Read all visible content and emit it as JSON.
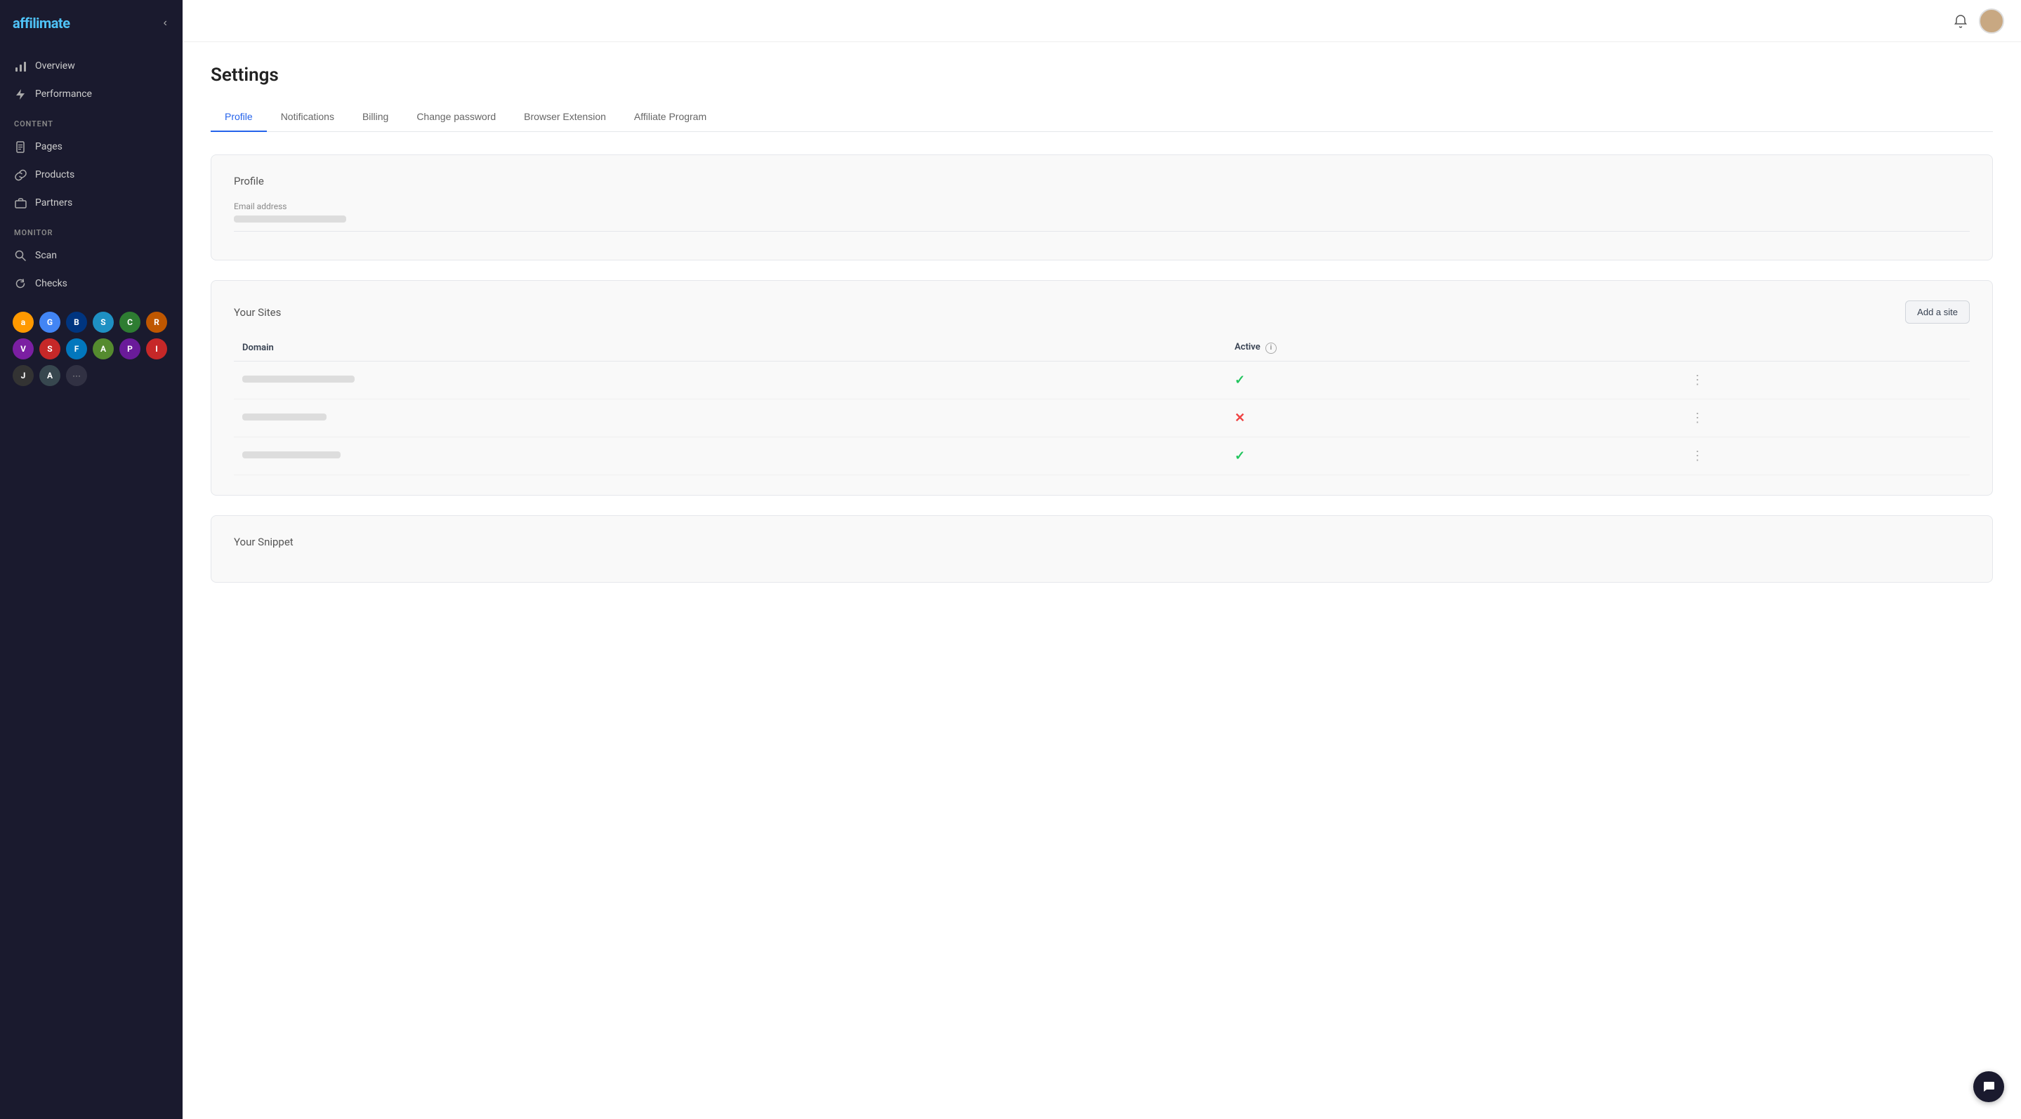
{
  "app": {
    "logo": "affilimate",
    "logo_accent": "·"
  },
  "sidebar": {
    "collapse_label": "‹",
    "nav_items": [
      {
        "id": "overview",
        "label": "Overview",
        "icon": "chart-icon"
      },
      {
        "id": "performance",
        "label": "Performance",
        "icon": "lightning-icon"
      }
    ],
    "sections": [
      {
        "label": "CONTENT",
        "items": [
          {
            "id": "pages",
            "label": "Pages",
            "icon": "page-icon"
          },
          {
            "id": "products",
            "label": "Products",
            "icon": "link-icon"
          },
          {
            "id": "partners",
            "label": "Partners",
            "icon": "briefcase-icon"
          }
        ]
      },
      {
        "label": "MONITOR",
        "items": [
          {
            "id": "scan",
            "label": "Scan",
            "icon": "search-icon"
          },
          {
            "id": "checks",
            "label": "Checks",
            "icon": "refresh-icon"
          }
        ]
      }
    ],
    "partner_icons": [
      {
        "id": "amazon",
        "letter": "a",
        "bg": "#FF9900",
        "color": "#fff"
      },
      {
        "id": "google",
        "letter": "G",
        "bg": "#4285F4",
        "color": "#fff"
      },
      {
        "id": "booking",
        "letter": "B",
        "bg": "#003580",
        "color": "#fff"
      },
      {
        "id": "skimlinks",
        "letter": "S",
        "bg": "#1e90c3",
        "color": "#fff"
      },
      {
        "id": "cj",
        "letter": "C",
        "bg": "#2e7d32",
        "color": "#fff"
      },
      {
        "id": "rakuten",
        "letter": "R",
        "bg": "#bf5700",
        "color": "#fff"
      },
      {
        "id": "viglink",
        "letter": "V",
        "bg": "#7b1fa2",
        "color": "#fff"
      },
      {
        "id": "shareasale",
        "letter": "S",
        "bg": "#c62828",
        "color": "#fff"
      },
      {
        "id": "flexoffers",
        "letter": "F",
        "bg": "#0277bd",
        "color": "#fff"
      },
      {
        "id": "awin",
        "letter": "A",
        "bg": "#558b2f",
        "color": "#fff"
      },
      {
        "id": "partnerize",
        "letter": "P",
        "bg": "#6a1b9a",
        "color": "#fff"
      },
      {
        "id": "impact",
        "letter": "I",
        "bg": "#c62828",
        "color": "#fff"
      },
      {
        "id": "jrp",
        "letter": "J",
        "bg": "#333",
        "color": "#fff"
      },
      {
        "id": "other",
        "letter": "A",
        "bg": "#37474f",
        "color": "#fff"
      },
      {
        "id": "more",
        "letter": "···",
        "bg": "rgba(255,255,255,0.12)",
        "color": "#aaa"
      }
    ]
  },
  "topbar": {
    "bell_label": "🔔",
    "avatar_initials": "👤"
  },
  "page": {
    "title": "Settings"
  },
  "tabs": [
    {
      "id": "profile",
      "label": "Profile",
      "active": true
    },
    {
      "id": "notifications",
      "label": "Notifications",
      "active": false
    },
    {
      "id": "billing",
      "label": "Billing",
      "active": false
    },
    {
      "id": "change-password",
      "label": "Change password",
      "active": false
    },
    {
      "id": "browser-extension",
      "label": "Browser Extension",
      "active": false
    },
    {
      "id": "affiliate-program",
      "label": "Affiliate Program",
      "active": false
    }
  ],
  "profile_section": {
    "title": "Profile",
    "email_label": "Email address",
    "email_placeholder": "Email address"
  },
  "sites_section": {
    "title": "Your Sites",
    "add_button": "Add a site",
    "columns": [
      {
        "id": "domain",
        "label": "Domain"
      },
      {
        "id": "active",
        "label": "Active"
      }
    ],
    "rows": [
      {
        "domain_width": 160,
        "active": true
      },
      {
        "domain_width": 120,
        "active": false
      },
      {
        "domain_width": 140,
        "active": true
      }
    ]
  },
  "snippet_section": {
    "title": "Your Snippet"
  }
}
